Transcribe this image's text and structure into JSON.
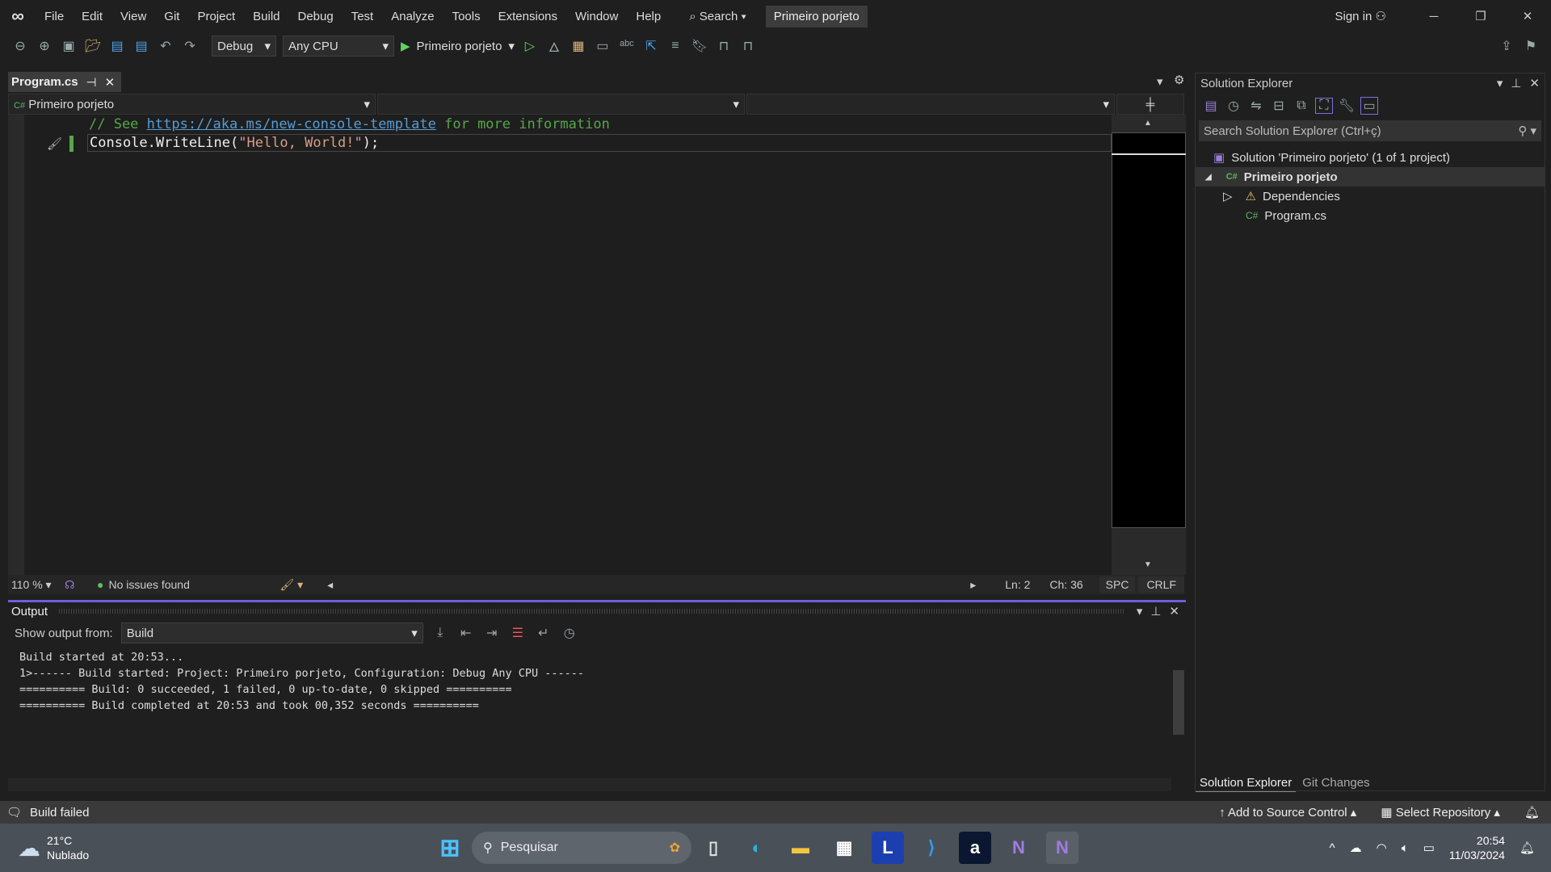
{
  "menu": [
    "File",
    "Edit",
    "View",
    "Git",
    "Project",
    "Build",
    "Debug",
    "Test",
    "Analyze",
    "Tools",
    "Extensions",
    "Window",
    "Help"
  ],
  "search_label": "Search",
  "solution_name_badge": "Primeiro porjeto",
  "sign_in": "Sign in",
  "toolbar": {
    "configuration": "Debug",
    "platform": "Any CPU",
    "start_target": "Primeiro porjeto"
  },
  "doc_tab": {
    "label": "Program.cs"
  },
  "navbar": {
    "project": "Primeiro porjeto",
    "member": "",
    "scope": ""
  },
  "code": {
    "line1_comment_pre": "// See ",
    "line1_link": "https://aka.ms/new-console-template",
    "line1_comment_post": " for more information",
    "line2_a": "Console.WriteLine(",
    "line2_str": "\"Hello, World!\"",
    "line2_b": ");"
  },
  "editor_status": {
    "zoom": "110 %",
    "issues": "No issues found",
    "ln": "Ln: 2",
    "ch": "Ch: 36",
    "spc": "SPC",
    "crlf": "CRLF"
  },
  "output": {
    "title": "Output",
    "show_from_label": "Show output from:",
    "source": "Build",
    "lines": [
      "Build started at 20:53...",
      "1>------ Build started: Project: Primeiro porjeto, Configuration: Debug Any CPU ------",
      "========== Build: 0 succeeded, 1 failed, 0 up-to-date, 0 skipped ==========",
      "========== Build completed at 20:53 and took 00,352 seconds =========="
    ]
  },
  "solution_explorer": {
    "title": "Solution Explorer",
    "search_placeholder": "Search Solution Explorer (Ctrl+ç)",
    "solution": "Solution 'Primeiro porjeto' (1 of 1 project)",
    "project": "Primeiro porjeto",
    "dependencies": "Dependencies",
    "file": "Program.cs",
    "tabs": [
      "Solution Explorer",
      "Git Changes"
    ]
  },
  "statusbar": {
    "message": "Build failed",
    "source_control": "Add to Source Control",
    "repository": "Select Repository"
  },
  "taskbar": {
    "temp": "21°C",
    "weather": "Nublado",
    "search": "Pesquisar",
    "time": "20:54",
    "date": "11/03/2024"
  },
  "colors": {
    "accent": "#6b5fdc",
    "comment": "#57a64a",
    "link": "#569cd6",
    "string": "#d69d85"
  }
}
